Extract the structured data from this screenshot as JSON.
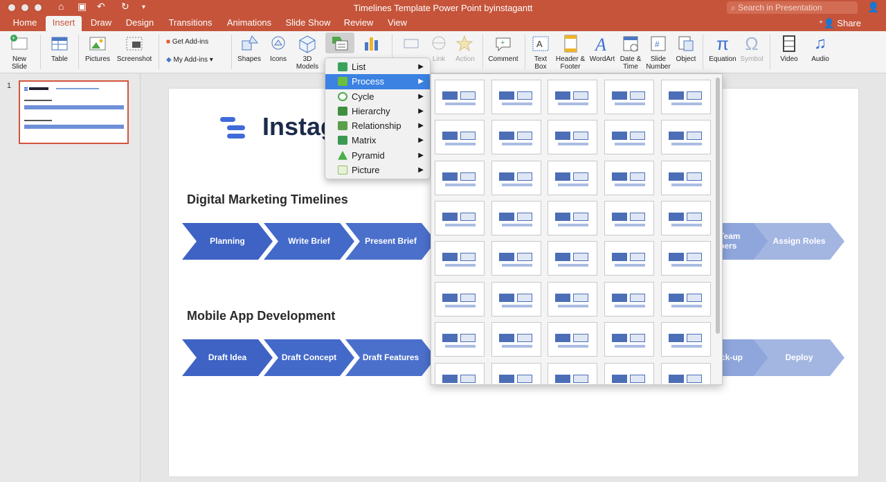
{
  "window": {
    "title": "Timelines Template Power Point byinstagantt"
  },
  "search": {
    "placeholder": "Search in Presentation"
  },
  "share_label": "Share",
  "tabs": [
    "Home",
    "Insert",
    "Draw",
    "Design",
    "Transitions",
    "Animations",
    "Slide Show",
    "Review",
    "View"
  ],
  "active_tab": "Insert",
  "ribbon": {
    "new_slide": "New\nSlide",
    "table": "Table",
    "pictures": "Pictures",
    "screenshot": "Screenshot",
    "get_addins": "Get Add-ins",
    "my_addins": "My Add-ins",
    "shapes": "Shapes",
    "icons": "Icons",
    "models3d": "3D\nModels",
    "link": "Link",
    "action": "Action",
    "comment": "Comment",
    "text_box": "Text\nBox",
    "header_footer": "Header &\nFooter",
    "wordart": "WordArt",
    "date_time": "Date &\nTime",
    "slide_number": "Slide\nNumber",
    "object": "Object",
    "equation": "Equation",
    "symbol": "Symbol",
    "video": "Video",
    "audio": "Audio"
  },
  "slide_panel": {
    "number": "1"
  },
  "slide": {
    "logo_text": "Instag",
    "section1": {
      "title": "Digital Marketing Timelines",
      "steps": [
        "Planning",
        "Write Brief",
        "Present Brief",
        "Team\nbers",
        "Assign Roles"
      ]
    },
    "section2": {
      "title": "Mobile App Development",
      "steps": [
        "Draft Idea",
        "Draft Concept",
        "Draft Features",
        "ck-up",
        "Deploy"
      ]
    }
  },
  "smartart_menu": {
    "items": [
      {
        "label": "List",
        "color": "#3aa35a"
      },
      {
        "label": "Process",
        "color": "#6bbf3f"
      },
      {
        "label": "Cycle",
        "color": "#4fa84a"
      },
      {
        "label": "Hierarchy",
        "color": "#3f8f3f"
      },
      {
        "label": "Relationship",
        "color": "#5aa04a"
      },
      {
        "label": "Matrix",
        "color": "#3a9a52"
      },
      {
        "label": "Pyramid",
        "color": "#4bb04a"
      },
      {
        "label": "Picture",
        "color": "#8fbf6a"
      }
    ],
    "selected": "Process"
  },
  "colors": {
    "accent": "#c5543a",
    "slide_blue": "#3f6ad8",
    "menu_highlight": "#3b82e3"
  }
}
